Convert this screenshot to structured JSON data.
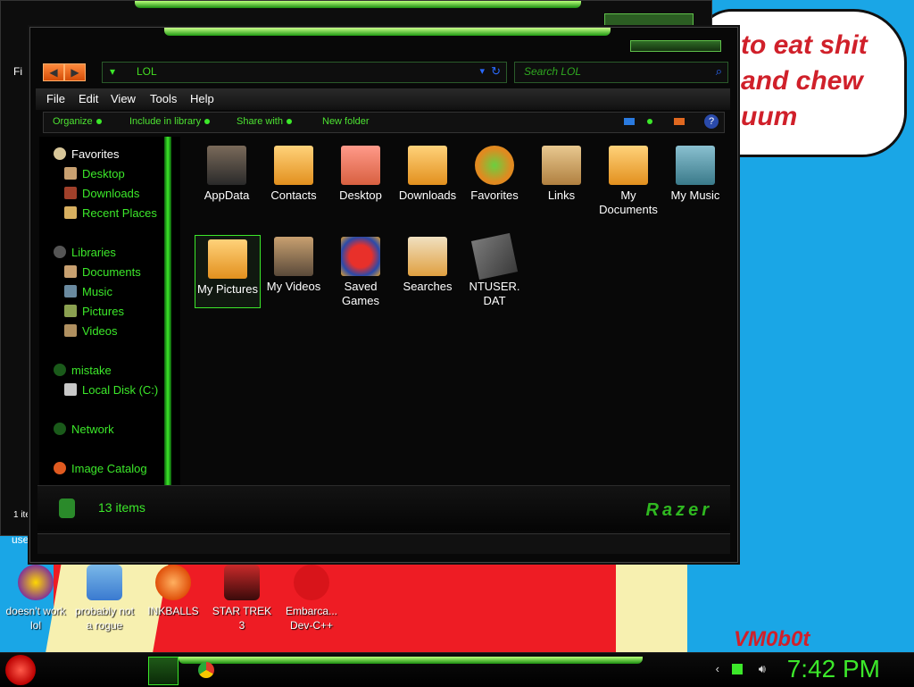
{
  "wallpaper": {
    "bubble_lines": [
      "to eat shit",
      "and chew",
      "uum"
    ],
    "watermark": "VM0b0t"
  },
  "background_window": {
    "fragments": [
      "Fi",
      "1 ite",
      "use"
    ]
  },
  "window": {
    "address": "LOL",
    "search_placeholder": "Search LOL",
    "menu": [
      "File",
      "Edit",
      "View",
      "Tools",
      "Help"
    ],
    "commands": [
      "Organize",
      "Include in library",
      "Share with",
      "New folder"
    ],
    "help_label": "?"
  },
  "sidebar": {
    "favorites_header": "Favorites",
    "favorites": [
      "Desktop",
      "Downloads",
      "Recent Places"
    ],
    "libraries_header": "Libraries",
    "libraries": [
      "Documents",
      "Music",
      "Pictures",
      "Videos"
    ],
    "computer_header": "mistake",
    "drives": [
      "Local Disk (C:)"
    ],
    "network": "Network",
    "image_catalog": "Image Catalog"
  },
  "files": [
    {
      "name": "AppData",
      "icon": "folder-icon"
    },
    {
      "name": "Contacts",
      "icon": "contacts-folder-icon"
    },
    {
      "name": "Desktop",
      "icon": "desktop-folder-icon"
    },
    {
      "name": "Downloads",
      "icon": "downloads-folder-icon"
    },
    {
      "name": "Favorites",
      "icon": "favorites-star-icon"
    },
    {
      "name": "Links",
      "icon": "links-folder-icon"
    },
    {
      "name": "My Documents",
      "icon": "documents-folder-icon"
    },
    {
      "name": "My Music",
      "icon": "music-folder-icon"
    },
    {
      "name": "My Pictures",
      "icon": "pictures-folder-icon",
      "selected": true
    },
    {
      "name": "My Videos",
      "icon": "videos-folder-icon"
    },
    {
      "name": "Saved Games",
      "icon": "saved-games-icon"
    },
    {
      "name": "Searches",
      "icon": "searches-folder-icon"
    },
    {
      "name": "NTUSER. DAT",
      "icon": "dat-file-icon"
    }
  ],
  "status": {
    "count": "13 items",
    "brand": "Razer"
  },
  "desktop_icons": [
    {
      "label": "doesn't work lol",
      "icon": "yahoo-messenger-icon"
    },
    {
      "label": "probably not a rogue",
      "icon": "settings-gears-icon"
    },
    {
      "label": "INKBALLS",
      "icon": "inkball-icon"
    },
    {
      "label": "STAR TREK 3",
      "icon": "star-wars-game-icon"
    },
    {
      "label": "Embarca... Dev-C++",
      "icon": "dev-cpp-icon"
    }
  ],
  "taskbar": {
    "time": "7:42 PM"
  },
  "colors": {
    "accent": "#3ce82a",
    "window_bg": "#080808",
    "desktop_bg": "#1aa6e6"
  }
}
